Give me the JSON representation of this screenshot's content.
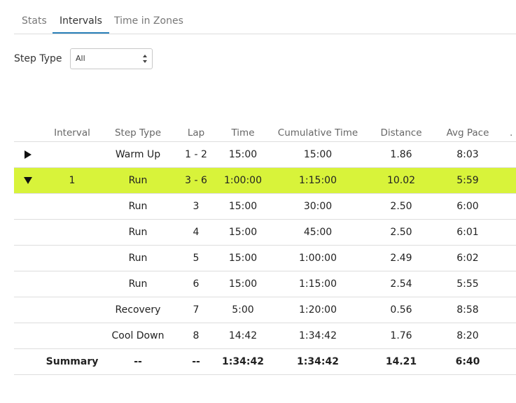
{
  "tabs": [
    {
      "label": "Stats",
      "active": false
    },
    {
      "label": "Intervals",
      "active": true
    },
    {
      "label": "Time in Zones",
      "active": false
    }
  ],
  "filter": {
    "label": "Step Type",
    "selected": "All"
  },
  "table": {
    "headers": {
      "interval": "Interval",
      "step_type": "Step Type",
      "lap": "Lap",
      "time": "Time",
      "cumulative_time": "Cumulative Time",
      "distance": "Distance",
      "avg_pace": "Avg Pace",
      "extra": "."
    },
    "rows": [
      {
        "toggle": "collapsed",
        "interval": "",
        "step_type": "Warm Up",
        "lap": "1 - 2",
        "time": "15:00",
        "cumulative_time": "15:00",
        "distance": "1.86",
        "avg_pace": "8:03"
      },
      {
        "toggle": "expanded",
        "interval": "1",
        "step_type": "Run",
        "lap": "3 - 6",
        "time": "1:00:00",
        "cumulative_time": "1:15:00",
        "distance": "10.02",
        "avg_pace": "5:59",
        "highlight": true
      },
      {
        "toggle": "",
        "interval": "",
        "step_type": "Run",
        "lap": "3",
        "time": "15:00",
        "cumulative_time": "30:00",
        "distance": "2.50",
        "avg_pace": "6:00"
      },
      {
        "toggle": "",
        "interval": "",
        "step_type": "Run",
        "lap": "4",
        "time": "15:00",
        "cumulative_time": "45:00",
        "distance": "2.50",
        "avg_pace": "6:01"
      },
      {
        "toggle": "",
        "interval": "",
        "step_type": "Run",
        "lap": "5",
        "time": "15:00",
        "cumulative_time": "1:00:00",
        "distance": "2.49",
        "avg_pace": "6:02"
      },
      {
        "toggle": "",
        "interval": "",
        "step_type": "Run",
        "lap": "6",
        "time": "15:00",
        "cumulative_time": "1:15:00",
        "distance": "2.54",
        "avg_pace": "5:55"
      },
      {
        "toggle": "",
        "interval": "",
        "step_type": "Recovery",
        "lap": "7",
        "time": "5:00",
        "cumulative_time": "1:20:00",
        "distance": "0.56",
        "avg_pace": "8:58"
      },
      {
        "toggle": "",
        "interval": "",
        "step_type": "Cool Down",
        "lap": "8",
        "time": "14:42",
        "cumulative_time": "1:34:42",
        "distance": "1.76",
        "avg_pace": "8:20"
      }
    ],
    "summary": {
      "interval": "Summary",
      "step_type": "--",
      "lap": "--",
      "time": "1:34:42",
      "cumulative_time": "1:34:42",
      "distance": "14.21",
      "avg_pace": "6:40"
    }
  },
  "colors": {
    "highlight": "#d8f33a",
    "active_tab_underline": "#2a80b9"
  },
  "icons": {
    "collapsed": "triangle-right-icon",
    "expanded": "triangle-down-icon",
    "select": "select-arrows-icon"
  }
}
